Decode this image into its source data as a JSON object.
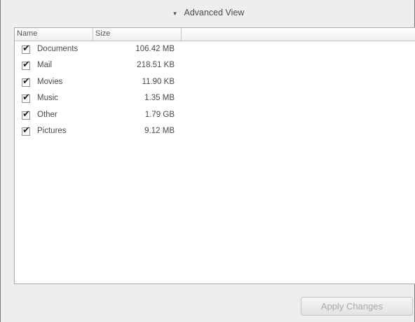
{
  "disclosure": {
    "icon": "triangle-down-icon",
    "label": "Advanced View"
  },
  "table": {
    "columns": [
      "Name",
      "Size"
    ],
    "rows": [
      {
        "name": "Documents",
        "size": "106.42 MB",
        "checked": true
      },
      {
        "name": "Mail",
        "size": "218.51 KB",
        "checked": true
      },
      {
        "name": "Movies",
        "size": "11.90 KB",
        "checked": true
      },
      {
        "name": "Music",
        "size": "1.35 MB",
        "checked": true
      },
      {
        "name": "Other",
        "size": "1.79 GB",
        "checked": true
      },
      {
        "name": "Pictures",
        "size": "9.12 MB",
        "checked": true
      }
    ]
  },
  "actions": {
    "apply_label": "Apply Changes",
    "apply_enabled": false
  }
}
